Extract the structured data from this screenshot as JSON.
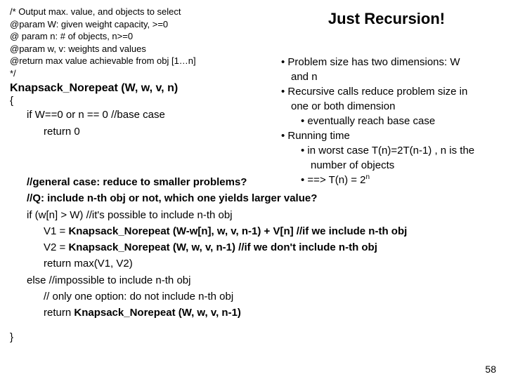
{
  "title": "Just Recursion!",
  "doc": {
    "l1": "/*  Output max. value, and objects to select",
    "l2": "@param W: given weight capacity, >=0",
    "l3": "@ param n: # of objects, n>=0",
    "l4": "@param w, v: weights and values",
    "l5": "@return max value achievable from obj [1…n]",
    "l6": "*/"
  },
  "sig": "Knapsack_Norepeat (W, w, v, n)",
  "open": "{",
  "base_if": "if W==0 or n == 0      //base case",
  "base_ret": "return 0",
  "gen1": "//general case: reduce to smaller problems?",
  "gen2": "//Q: include n-th obj or not, which one yields larger value?",
  "ifw": "if (w[n] > W) //it's possible to include n-th obj",
  "v1a": "V1 = ",
  "v1b": "Knapsack_Norepeat (W-w[n], w, v, n-1) + V[n] //if we include n-th obj",
  "v2a": "V2 = ",
  "v2b": "Knapsack_Norepeat (W, w, v, n-1)   //if we don't include n-th obj",
  "retmax": "return max(V1, V2)",
  "elseline": "else //impossible to include n-th obj",
  "onlyopt": "// only one option: do not include n-th obj",
  "retelse_a": "return  ",
  "retelse_b": "Knapsack_Norepeat (W, w, v, n-1)",
  "close": "}",
  "bul": {
    "b1": "• Problem size has two dimensions: W",
    "b1c": "and n",
    "b2": "• Recursive calls reduce problem size in",
    "b2c": "one or both dimension",
    "b2s": "• eventually reach base case",
    "b3": "• Running time",
    "b3s1": "• in worst case T(n)=2T(n-1) , n is the",
    "b3s1c": "number of objects",
    "b3s2a": "• ==> T(n) = 2",
    "b3s2b": "n"
  },
  "pagenum": "58"
}
